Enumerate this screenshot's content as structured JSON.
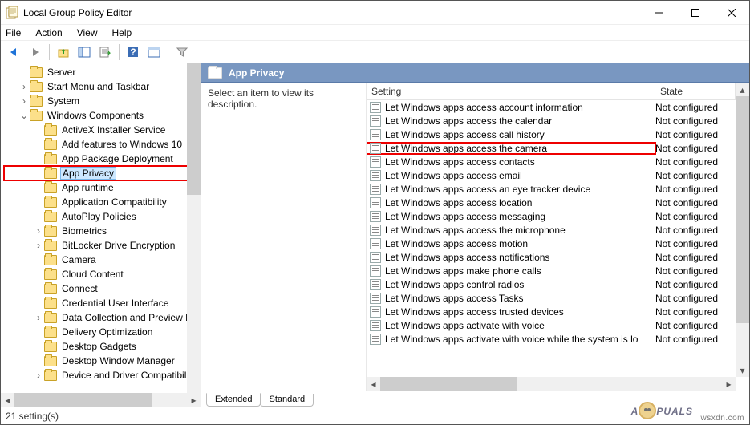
{
  "window": {
    "title": "Local Group Policy Editor"
  },
  "menu": {
    "file": "File",
    "action": "Action",
    "view": "View",
    "help": "Help"
  },
  "tree": {
    "items": [
      {
        "depth": 1,
        "tw": "",
        "label": "Server"
      },
      {
        "depth": 1,
        "tw": "›",
        "label": "Start Menu and Taskbar"
      },
      {
        "depth": 1,
        "tw": "›",
        "label": "System"
      },
      {
        "depth": 1,
        "tw": "⌄",
        "label": "Windows Components"
      },
      {
        "depth": 2,
        "tw": "",
        "label": "ActiveX Installer Service"
      },
      {
        "depth": 2,
        "tw": "",
        "label": "Add features to Windows 10"
      },
      {
        "depth": 2,
        "tw": "",
        "label": "App Package Deployment"
      },
      {
        "depth": 2,
        "tw": "",
        "label": "App Privacy",
        "selected": true,
        "highlight": true
      },
      {
        "depth": 2,
        "tw": "",
        "label": "App runtime"
      },
      {
        "depth": 2,
        "tw": "",
        "label": "Application Compatibility"
      },
      {
        "depth": 2,
        "tw": "",
        "label": "AutoPlay Policies"
      },
      {
        "depth": 2,
        "tw": "›",
        "label": "Biometrics"
      },
      {
        "depth": 2,
        "tw": "›",
        "label": "BitLocker Drive Encryption"
      },
      {
        "depth": 2,
        "tw": "",
        "label": "Camera"
      },
      {
        "depth": 2,
        "tw": "",
        "label": "Cloud Content"
      },
      {
        "depth": 2,
        "tw": "",
        "label": "Connect"
      },
      {
        "depth": 2,
        "tw": "",
        "label": "Credential User Interface"
      },
      {
        "depth": 2,
        "tw": "›",
        "label": "Data Collection and Preview B"
      },
      {
        "depth": 2,
        "tw": "",
        "label": "Delivery Optimization"
      },
      {
        "depth": 2,
        "tw": "",
        "label": "Desktop Gadgets"
      },
      {
        "depth": 2,
        "tw": "",
        "label": "Desktop Window Manager"
      },
      {
        "depth": 2,
        "tw": "›",
        "label": "Device and Driver Compatibilit"
      }
    ]
  },
  "right": {
    "header": "App Privacy",
    "desc": "Select an item to view its description.",
    "columns": {
      "setting": "Setting",
      "state": "State"
    },
    "rows": [
      {
        "name": "Let Windows apps access account information",
        "state": "Not configured"
      },
      {
        "name": "Let Windows apps access the calendar",
        "state": "Not configured"
      },
      {
        "name": "Let Windows apps access call history",
        "state": "Not configured"
      },
      {
        "name": "Let Windows apps access the camera",
        "state": "Not configured",
        "highlight": true
      },
      {
        "name": "Let Windows apps access contacts",
        "state": "Not configured"
      },
      {
        "name": "Let Windows apps access email",
        "state": "Not configured"
      },
      {
        "name": "Let Windows apps access an eye tracker device",
        "state": "Not configured"
      },
      {
        "name": "Let Windows apps access location",
        "state": "Not configured"
      },
      {
        "name": "Let Windows apps access messaging",
        "state": "Not configured"
      },
      {
        "name": "Let Windows apps access the microphone",
        "state": "Not configured"
      },
      {
        "name": "Let Windows apps access motion",
        "state": "Not configured"
      },
      {
        "name": "Let Windows apps access notifications",
        "state": "Not configured"
      },
      {
        "name": "Let Windows apps make phone calls",
        "state": "Not configured"
      },
      {
        "name": "Let Windows apps control radios",
        "state": "Not configured"
      },
      {
        "name": "Let Windows apps access Tasks",
        "state": "Not configured"
      },
      {
        "name": "Let Windows apps access trusted devices",
        "state": "Not configured"
      },
      {
        "name": "Let Windows apps activate with voice",
        "state": "Not configured"
      },
      {
        "name": "Let Windows apps activate with voice while the system is lo",
        "state": "Not configured"
      }
    ],
    "tabs": {
      "extended": "Extended",
      "standard": "Standard"
    }
  },
  "status": {
    "text": "21 setting(s)"
  },
  "watermark": "wsxdn.com",
  "logo": {
    "left": "A",
    "right": "PUALS"
  }
}
